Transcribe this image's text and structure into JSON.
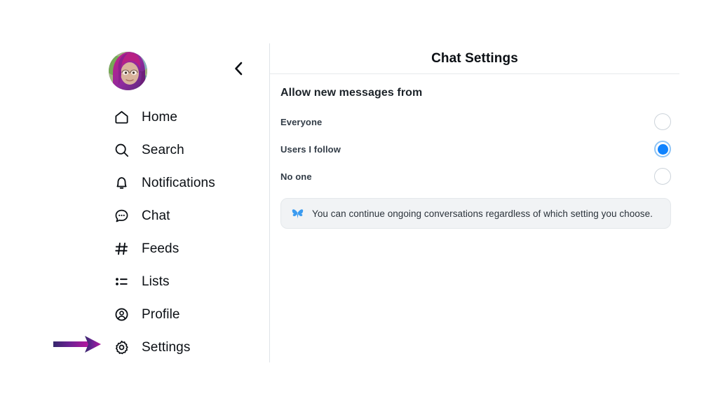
{
  "sidebar": {
    "avatar_alt": "user-avatar",
    "back_icon": "chevron-left-icon",
    "items": [
      {
        "label": "Home",
        "icon": "home-icon"
      },
      {
        "label": "Search",
        "icon": "search-icon"
      },
      {
        "label": "Notifications",
        "icon": "bell-icon"
      },
      {
        "label": "Chat",
        "icon": "chat-bubble-icon"
      },
      {
        "label": "Feeds",
        "icon": "hashtag-icon"
      },
      {
        "label": "Lists",
        "icon": "list-icon"
      },
      {
        "label": "Profile",
        "icon": "person-circle-icon"
      },
      {
        "label": "Settings",
        "icon": "gear-icon"
      }
    ],
    "annotation": {
      "icon": "arrow-right-annotation",
      "points_to": "Settings",
      "gradient_start": "#35276b",
      "gradient_end": "#b5179e"
    }
  },
  "main": {
    "title": "Chat Settings",
    "section_heading": "Allow new messages from",
    "options": [
      {
        "label": "Everyone",
        "selected": false
      },
      {
        "label": "Users I follow",
        "selected": true
      },
      {
        "label": "No one",
        "selected": false
      }
    ],
    "notice": {
      "icon": "bluesky-butterfly-icon",
      "text": "You can continue ongoing conversations regardless of which setting you choose."
    }
  },
  "colors": {
    "accent": "#1083fe",
    "accent_ring": "#8fc4f5",
    "text_primary": "#0b0f14",
    "text_secondary": "#323c47",
    "divider": "#dfe3e8",
    "notice_bg": "#f1f3f5"
  }
}
